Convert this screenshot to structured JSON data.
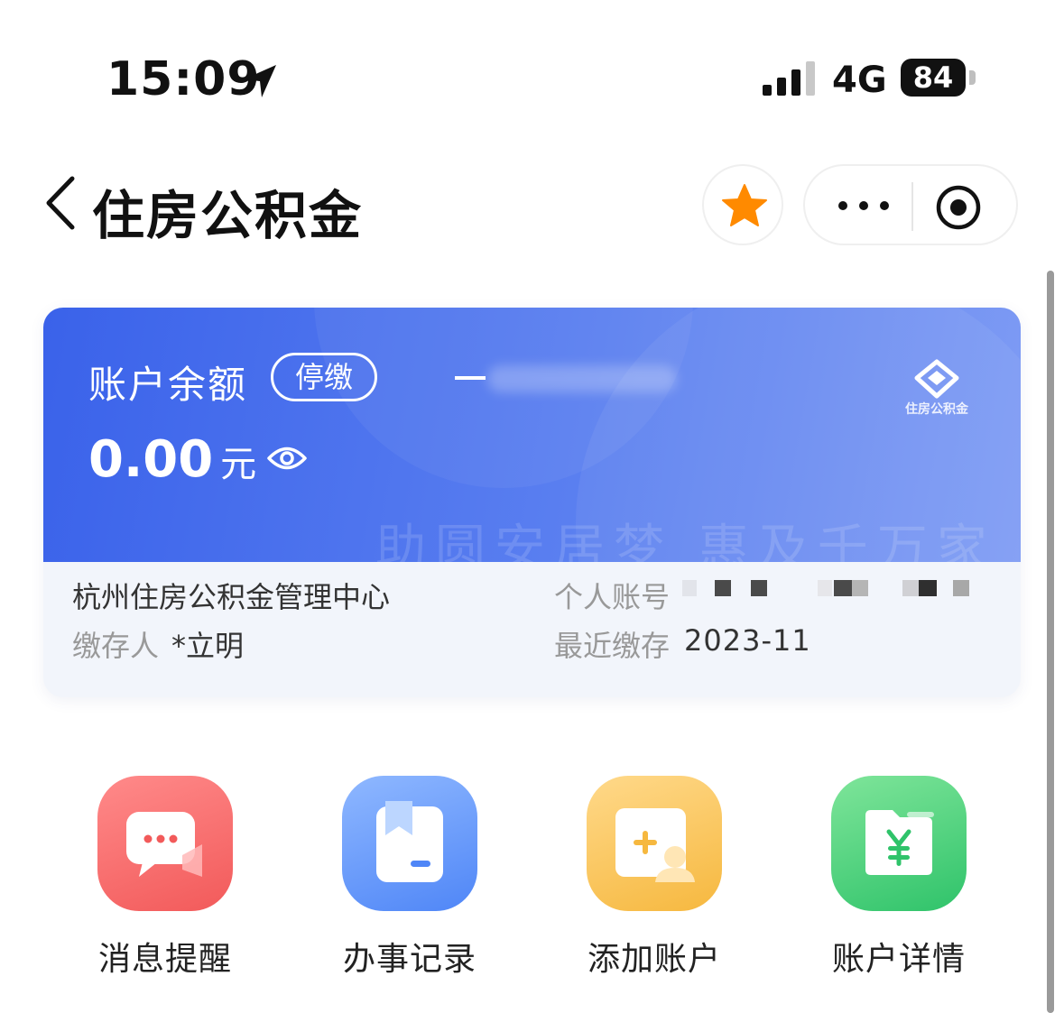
{
  "status_bar": {
    "time": "15:09",
    "network": "4G",
    "battery": "84"
  },
  "nav": {
    "title": "住房公积金"
  },
  "card": {
    "balance_label": "账户余额",
    "status_badge": "停缴",
    "balance_value": "0.00",
    "balance_unit": "元",
    "logo_text": "住房公积金",
    "slogan": "助圆安居梦  惠及千万家",
    "center_name": "杭州住房公积金管理中心",
    "payer_label": "缴存人",
    "payer_name": "*立明",
    "account_label": "个人账号",
    "recent_label": "最近缴存",
    "recent_date": "2023-11"
  },
  "actions": [
    {
      "label": "消息提醒",
      "icon": "message-icon",
      "color": "#f25a5a"
    },
    {
      "label": "办事记录",
      "icon": "record-icon",
      "color": "#4f86f7"
    },
    {
      "label": "添加账户",
      "icon": "add-account-icon",
      "color": "#f6b83f"
    },
    {
      "label": "账户详情",
      "icon": "account-detail-icon",
      "color": "#2fc36a"
    }
  ],
  "colors": {
    "card_blue": "#3a62ea",
    "star": "#ff8a00"
  }
}
